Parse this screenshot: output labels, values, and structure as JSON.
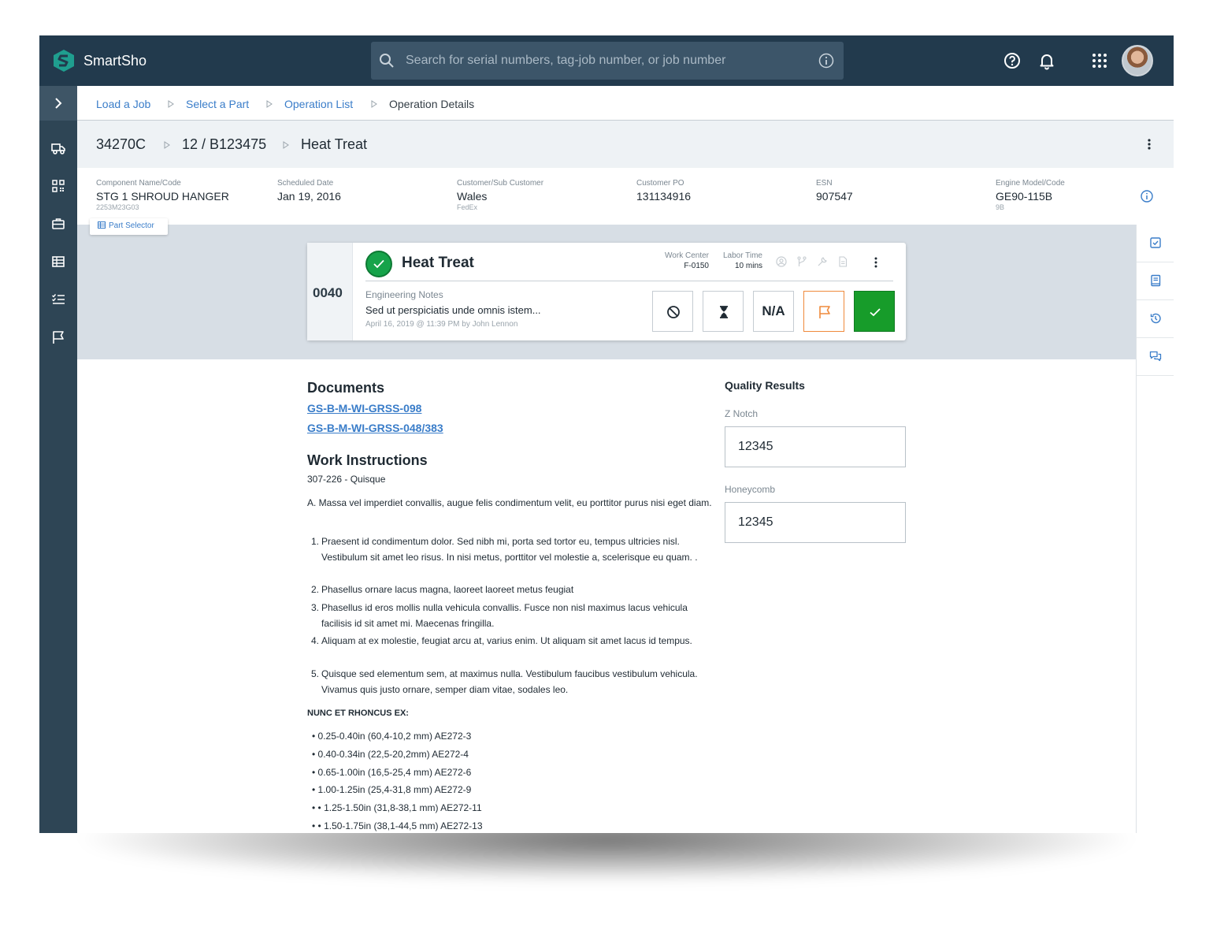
{
  "app": {
    "brand": "SmartSho"
  },
  "search": {
    "placeholder": "Search for serial numbers, tag-job number, or job number"
  },
  "breadcrumbs": [
    {
      "label": "Load a Job"
    },
    {
      "label": "Select a Part"
    },
    {
      "label": "Operation List"
    },
    {
      "label": "Operation Details"
    }
  ],
  "title": {
    "job": "34270C",
    "part": "12 / B123475",
    "operation": "Heat Treat"
  },
  "info": [
    {
      "label": "Component Name/Code",
      "value": "STG 1 SHROUD HANGER",
      "sub": "2253M23G03"
    },
    {
      "label": "Scheduled Date",
      "value": "Jan 19, 2016",
      "sub": ""
    },
    {
      "label": "Customer/Sub Customer",
      "value": "Wales",
      "sub": "FedEx"
    },
    {
      "label": "Customer PO",
      "value": "131134916",
      "sub": ""
    },
    {
      "label": "ESN",
      "value": "907547",
      "sub": ""
    },
    {
      "label": "Engine Model/Code",
      "value": "GE90-115B",
      "sub": "9B"
    }
  ],
  "part_selector": {
    "label": "Part Selector"
  },
  "operation": {
    "number": "0040",
    "name": "Heat Treat",
    "work_center_label": "Work Center",
    "work_center": "F-0150",
    "labor_time_label": "Labor Time",
    "labor_time": "10 mins",
    "notes_label": "Engineering Notes",
    "notes": "Sed ut perspiciatis unde omnis istem...",
    "notes_meta": "April 16, 2019 @ 11:39 PM by John Lennon",
    "na_label": "N/A"
  },
  "documents": {
    "heading": "Documents",
    "links": [
      "GS-B-M-WI-GRSS-098",
      "GS-B-M-WI-GRSS-048/383"
    ]
  },
  "work_instructions": {
    "heading": "Work Instructions",
    "subtitle": "307-226 - Quisque",
    "intro": "A.  Massa vel imperdiet convallis, augue felis condimentum velit, eu porttitor purus nisi eget diam.",
    "steps": [
      {
        "num": "1.",
        "text": "Praesent id condimentum dolor. Sed nibh mi, porta sed tortor eu, tempus ultricies nisl. Vestibulum sit amet leo risus. In nisi metus, porttitor vel molestie a, scelerisque eu quam. ."
      },
      {
        "num": "2.",
        "text": "Phasellus ornare lacus magna, laoreet laoreet metus feugiat"
      },
      {
        "num": "3.",
        "text": "Phasellus id eros mollis nulla vehicula convallis. Fusce non nisl maximus lacus vehicula facilisis id sit amet mi. Maecenas fringilla."
      },
      {
        "num": "4.",
        "text": "Aliquam at ex molestie, feugiat arcu at, varius enim. Ut aliquam sit amet lacus id tempus."
      },
      {
        "num": "5.",
        "text": "Quisque sed elementum sem, at maximus nulla. Vestibulum faucibus vestibulum vehicula. Vivamus quis justo ornare, semper diam vitae, sodales leo."
      }
    ],
    "section_label": "NUNC ET RHONCUS EX:",
    "bullets": [
      "•  0.25-0.40in (60,4-10,2 mm) AE272-3",
      "•  0.40-0.34in (22,5-20,2mm)  AE272-4",
      "•  0.65-1.00in (16,5-25,4 mm) AE272-6",
      "•  1.00-1.25in (25,4-31,8 mm) AE272-9",
      "•  •  1.25-1.50in (31,8-38,1 mm) AE272-11",
      "•  •  1.50-1.75in (38,1-44,5 mm) AE272-13"
    ]
  },
  "quality": {
    "heading": "Quality Results",
    "fields": [
      {
        "label": "Z Notch",
        "value": "12345"
      },
      {
        "label": "Honeycomb",
        "value": "12345"
      }
    ]
  },
  "colors": {
    "topbar": "#223a4d",
    "sidenav": "#2e4555",
    "link": "#3a7dc9",
    "success": "#179c2a",
    "flag": "#ef8a3c"
  }
}
